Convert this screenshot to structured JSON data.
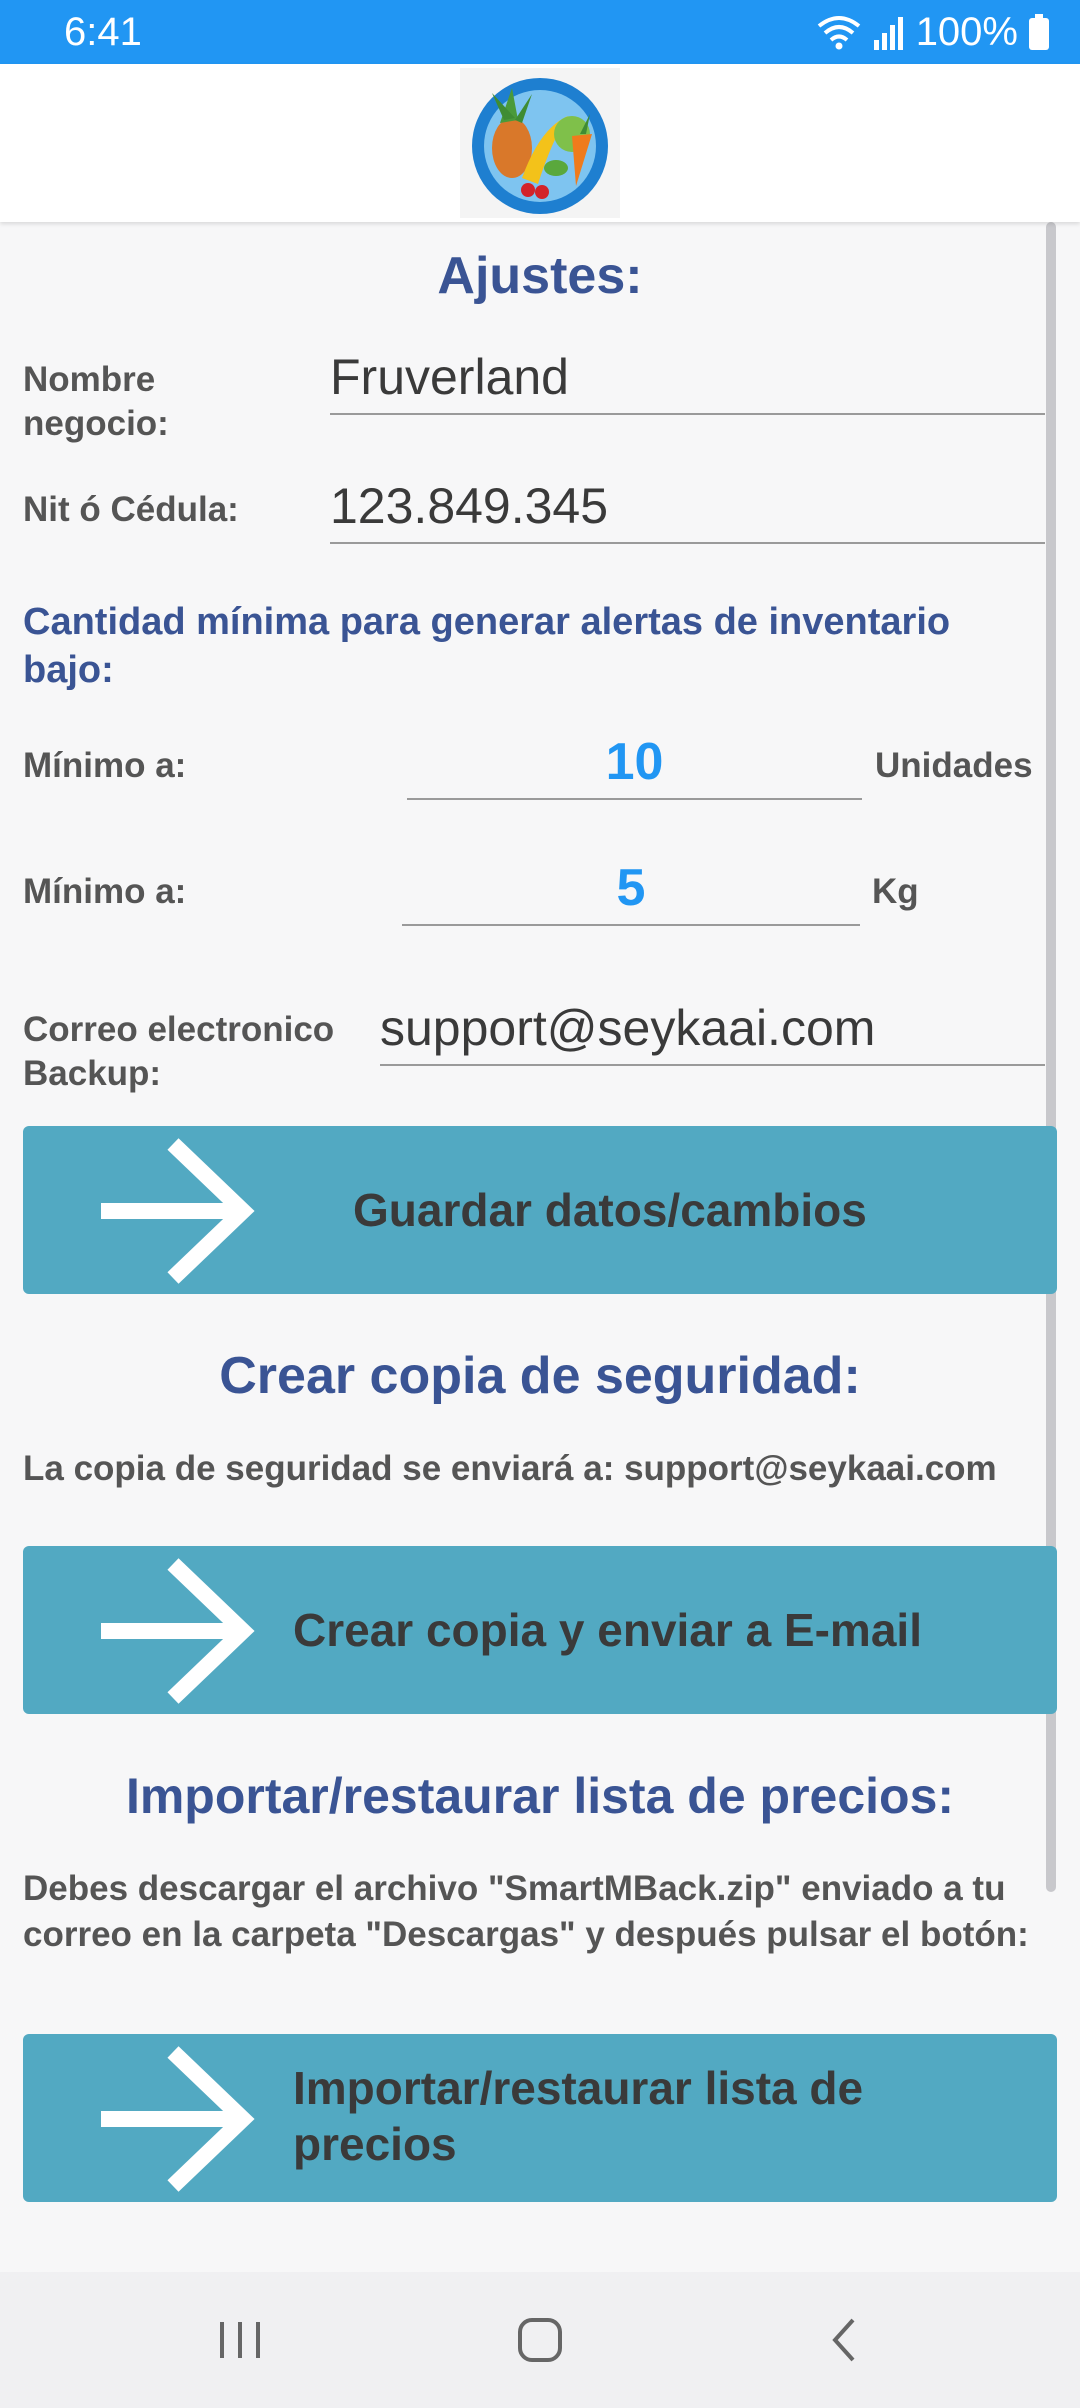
{
  "status_bar": {
    "time": "6:41",
    "battery": "100%",
    "color": "#2196f3"
  },
  "app_bar": {
    "logo_icon": "fruit-basket-logo"
  },
  "settings": {
    "title": "Ajustes:",
    "business_name_label": "Nombre negocio:",
    "business_name_value": "Fruverland",
    "nit_label": "Nit ó Cédula:",
    "nit_value": "123.849.345",
    "alert_subtitle": "Cantidad mínima para generar alertas de inventario bajo:",
    "min_units_label": "Mínimo a:",
    "min_units_value": "10",
    "min_units_unit": "Unidades",
    "min_kg_label": "Mínimo a:",
    "min_kg_value": "5",
    "min_kg_unit": "Kg",
    "email_label": "Correo electronico Backup:",
    "email_value": "support@seykaai.com",
    "save_button_label": "Guardar datos/cambios"
  },
  "backup": {
    "title": "Crear copia de seguridad:",
    "description": "La copia de seguridad se enviará a: support@seykaai.com",
    "button_label": "Crear copia y enviar a E-mail"
  },
  "restore": {
    "title": "Importar/restaurar lista de precios:",
    "description": "Debes descargar el archivo \"SmartMBack.zip\" enviado a tu correo en la carpeta \"Descargas\" y después pulsar el botón:",
    "button_label": "Importar/restaurar lista de precios"
  },
  "colors": {
    "button_bg": "#52a9c2",
    "accent_title": "#3a5494",
    "number_accent": "#2196f3"
  },
  "nav_bar": {
    "recent_icon": "recent-apps-icon",
    "home_icon": "home-icon",
    "back_icon": "back-icon"
  }
}
